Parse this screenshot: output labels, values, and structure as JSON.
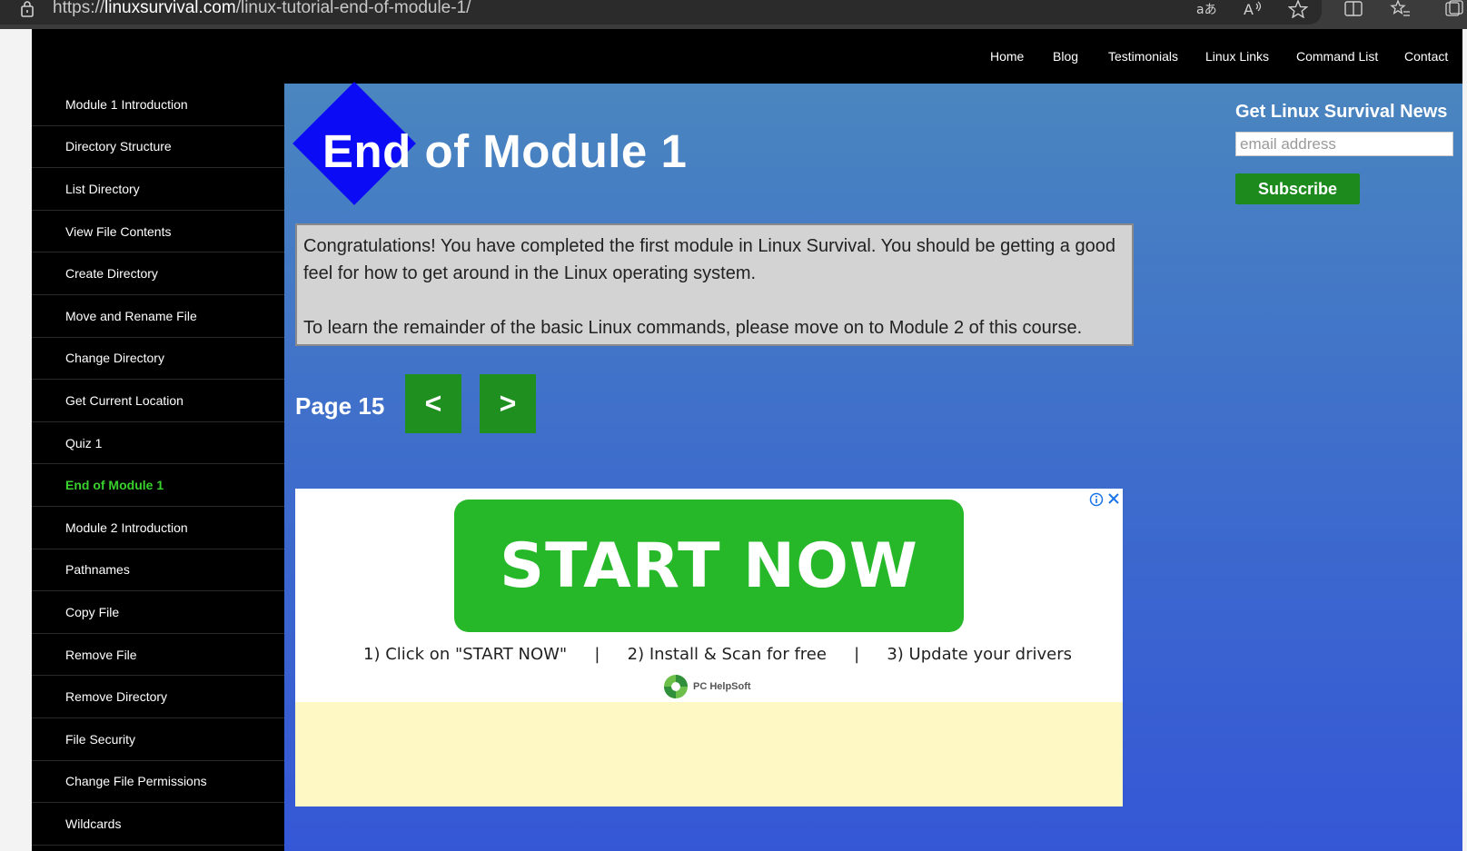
{
  "browser": {
    "url_prefix": "https://",
    "url_host": "linuxsurvival.com",
    "url_path": "/linux-tutorial-end-of-module-1/"
  },
  "topnav": {
    "items": [
      "Home",
      "Blog",
      "Testimonials",
      "Linux Links",
      "Command List",
      "Contact"
    ]
  },
  "sidebar": {
    "items": [
      "Module 1 Introduction",
      "Directory Structure",
      "List Directory",
      "View File Contents",
      "Create Directory",
      "Move and Rename File",
      "Change Directory",
      "Get Current Location",
      "Quiz 1",
      "End of Module 1",
      "Module 2 Introduction",
      "Pathnames",
      "Copy File",
      "Remove File",
      "Remove Directory",
      "File Security",
      "Change File Permissions",
      "Wildcards"
    ],
    "active_index": 9
  },
  "main": {
    "title": "End of Module 1",
    "paragraph1": "Congratulations! You have completed the first module in Linux Survival. You should be getting a good feel for how to get around in the Linux operating system.",
    "paragraph2": "To learn the remainder of the basic Linux commands, please move on to Module 2 of this course.",
    "page_label": "Page 15",
    "prev_label": "<",
    "next_label": ">"
  },
  "ad": {
    "cta": "START NOW",
    "step1": "1) Click on \"START NOW\"",
    "sep": "|",
    "step2": "2) Install & Scan for free",
    "step3": "3) Update your drivers",
    "brand": "PC HelpSoft"
  },
  "newsletter": {
    "title": "Get Linux Survival News",
    "placeholder": "email address",
    "button": "Subscribe"
  },
  "colors": {
    "accent_green": "#1c8a1c",
    "active_link": "#39d12e",
    "diamond": "#0b0bf5"
  }
}
